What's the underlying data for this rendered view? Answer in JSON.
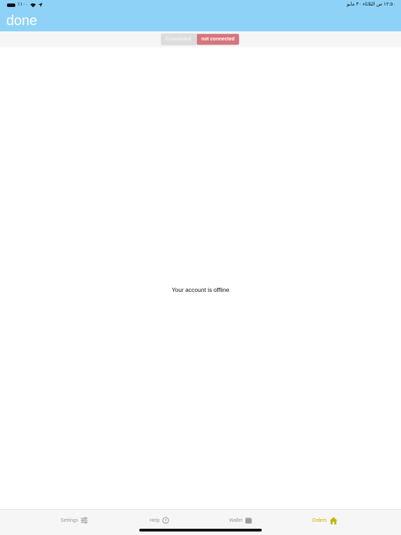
{
  "status_bar": {
    "battery_text": "٪١٠٠",
    "time_date": "١٢:٥٠ ص  الثلاثاء ٣٠ مايو"
  },
  "header": {
    "logo_text": "done",
    "brand_color": "#8ed3f7"
  },
  "segment": {
    "connected_label": "Connected",
    "not_connected_label": "not connected",
    "selected": "not connected",
    "selected_color": "#d9747c"
  },
  "main": {
    "message": "Your account is offline"
  },
  "tab_bar": {
    "tabs": [
      {
        "label": "Settings",
        "icon": "sliders-icon",
        "active": false
      },
      {
        "label": "Help",
        "icon": "info-icon",
        "active": false
      },
      {
        "label": "Wallet",
        "icon": "wallet-icon",
        "active": false
      },
      {
        "label": "Orders",
        "icon": "home-icon",
        "active": true
      }
    ],
    "active_color": "#c8b400"
  }
}
